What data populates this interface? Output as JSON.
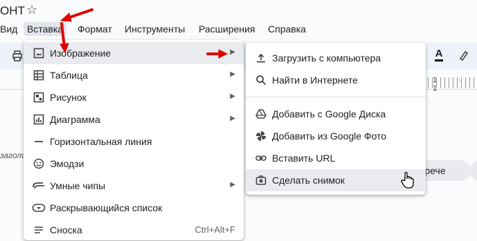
{
  "doc": {
    "title_fragment": "ОНТ"
  },
  "menubar": {
    "items": [
      "Вид",
      "Вставка",
      "Формат",
      "Инструменты",
      "Расширения",
      "Справка"
    ]
  },
  "main_menu": {
    "items": [
      {
        "label": "Изображение",
        "icon": "image-icon",
        "has_submenu": true
      },
      {
        "label": "Таблица",
        "icon": "table-icon",
        "has_submenu": true
      },
      {
        "label": "Рисунок",
        "icon": "drawing-icon",
        "has_submenu": true
      },
      {
        "label": "Диаграмма",
        "icon": "chart-icon",
        "has_submenu": true
      },
      {
        "label": "Горизонтальная линия",
        "icon": "horizontal-line-icon",
        "has_submenu": false
      },
      {
        "label": "Эмодзи",
        "icon": "emoji-icon",
        "has_submenu": false
      },
      {
        "label": "Умные чипы",
        "icon": "smart-chips-icon",
        "has_submenu": true
      },
      {
        "label": "Раскрывающийся список",
        "icon": "dropdown-icon",
        "has_submenu": false
      },
      {
        "label": "Сноска",
        "icon": "footnote-icon",
        "shortcut": "Ctrl+Alt+F"
      }
    ]
  },
  "submenu": {
    "items": [
      {
        "label": "Загрузить с компьютера",
        "icon": "upload-icon"
      },
      {
        "label": "Найти в Интернете",
        "icon": "search-icon"
      },
      {
        "label": "Добавить с Google Диска",
        "icon": "drive-icon"
      },
      {
        "label": "Добавить из Google Фото",
        "icon": "photos-icon"
      },
      {
        "label": "Вставить URL",
        "icon": "link-icon"
      },
      {
        "label": "Сделать снимок",
        "icon": "camera-icon"
      }
    ]
  },
  "background": {
    "left_text": "заголо",
    "chip_text": "стрече",
    "ruler_numbers": "1 · 1"
  },
  "colors": {
    "accent_red": "#e00000",
    "highlight": "#e9ebef",
    "toolbar_bg": "#edf2fa"
  }
}
